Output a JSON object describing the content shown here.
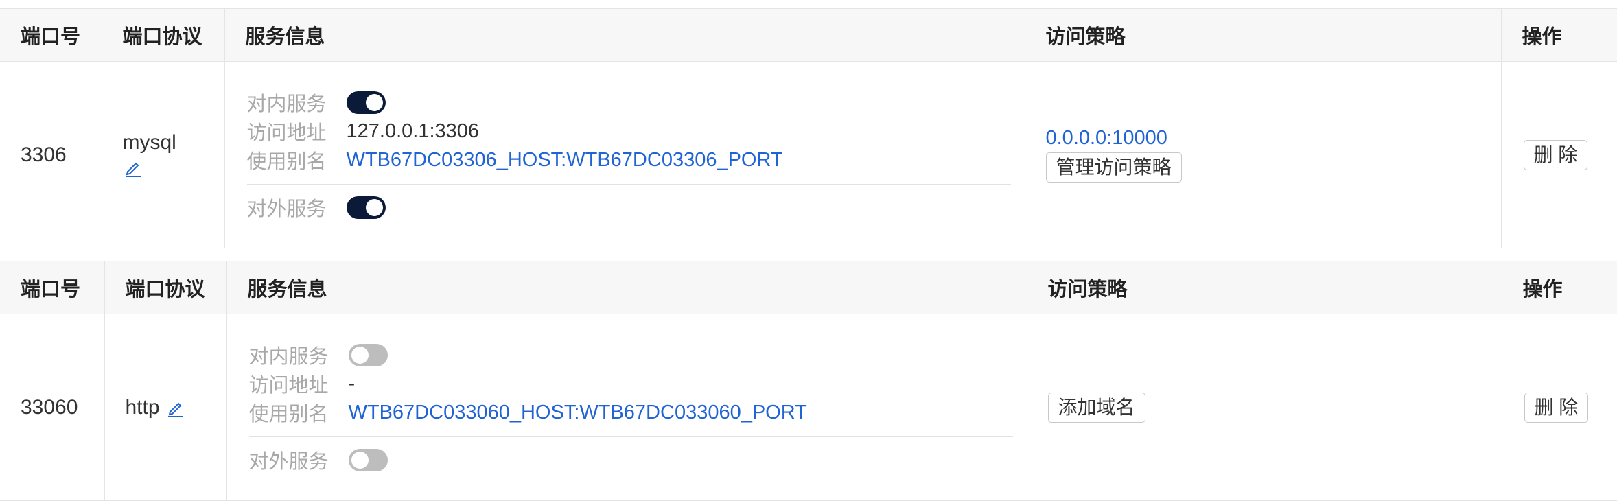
{
  "columns": {
    "port": "端口号",
    "protocol": "端口协议",
    "service": "服务信息",
    "policy": "访问策略",
    "actions": "操作"
  },
  "labels": {
    "internal_service": "对内服务",
    "access_address": "访问地址",
    "alias": "使用别名",
    "external_service": "对外服务"
  },
  "rows": [
    {
      "port": "3306",
      "protocol": "mysql",
      "internal_on": true,
      "access_address": "127.0.0.1:3306",
      "alias": "WTB67DC03306_HOST:WTB67DC03306_PORT",
      "external_on": true,
      "policy_link": "0.0.0.0:10000",
      "policy_button": "管理访问策略",
      "delete_button": "删 除"
    },
    {
      "port": "33060",
      "protocol": "http",
      "internal_on": false,
      "access_address": "-",
      "alias": "WTB67DC033060_HOST:WTB67DC033060_PORT",
      "external_on": false,
      "policy_button": "添加域名",
      "delete_button": "删 除"
    }
  ],
  "colors": {
    "toggle_on": "#0c1a3a",
    "toggle_off": "#bdbdbd",
    "link": "#1f63d4"
  },
  "icons": {
    "edit": "edit-icon"
  }
}
